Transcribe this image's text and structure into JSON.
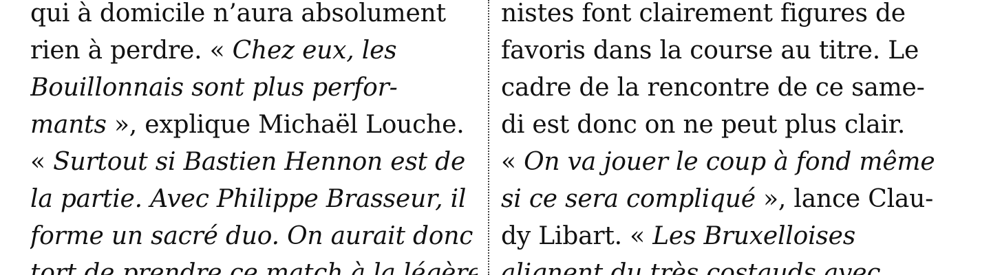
{
  "left_column": {
    "lines": [
      {
        "segments": [
          {
            "text": "qui à domicile n’aura absolument",
            "italic": false
          }
        ]
      },
      {
        "segments": [
          {
            "text": "rien à perdre. « ",
            "italic": false
          },
          {
            "text": "Chez eux, les",
            "italic": true
          }
        ]
      },
      {
        "segments": [
          {
            "text": "Bouillonnais sont plus perfor-",
            "italic": true
          }
        ]
      },
      {
        "segments": [
          {
            "text": "mants",
            "italic": true
          },
          {
            "text": " », explique Michaël Louche.",
            "italic": false
          }
        ]
      },
      {
        "segments": [
          {
            "text": "« ",
            "italic": false
          },
          {
            "text": "Surtout si Bastien Hennon est de",
            "italic": true
          }
        ]
      },
      {
        "segments": [
          {
            "text": "la partie. Avec Philippe Brasseur, il",
            "italic": true
          }
        ]
      },
      {
        "segments": [
          {
            "text": "forme un sacré duo. On aurait donc",
            "italic": true
          }
        ]
      },
      {
        "segments": [
          {
            "text": "tort de prendre ce match à la légère.",
            "italic": true
          }
        ]
      }
    ]
  },
  "right_column": {
    "lines": [
      {
        "segments": [
          {
            "text": "nistes font clairement figures de",
            "italic": false
          }
        ]
      },
      {
        "segments": [
          {
            "text": "favoris dans la course au titre. Le",
            "italic": false
          }
        ]
      },
      {
        "segments": [
          {
            "text": "cadre de la rencontre de ce same-",
            "italic": false
          }
        ]
      },
      {
        "segments": [
          {
            "text": "di est donc on ne peut plus clair.",
            "italic": false
          }
        ]
      },
      {
        "segments": [
          {
            "text": "« ",
            "italic": false
          },
          {
            "text": "On va jouer le coup à fond même",
            "italic": true
          }
        ]
      },
      {
        "segments": [
          {
            "text": "si ce sera compliqué",
            "italic": true
          },
          {
            "text": " », lance Clau-",
            "italic": false
          }
        ]
      },
      {
        "segments": [
          {
            "text": "dy Libart. « ",
            "italic": false
          },
          {
            "text": "Les Bruxelloises",
            "italic": true
          }
        ]
      },
      {
        "segments": [
          {
            "text": "alignent du très costauds avec",
            "italic": true
          }
        ]
      }
    ]
  }
}
